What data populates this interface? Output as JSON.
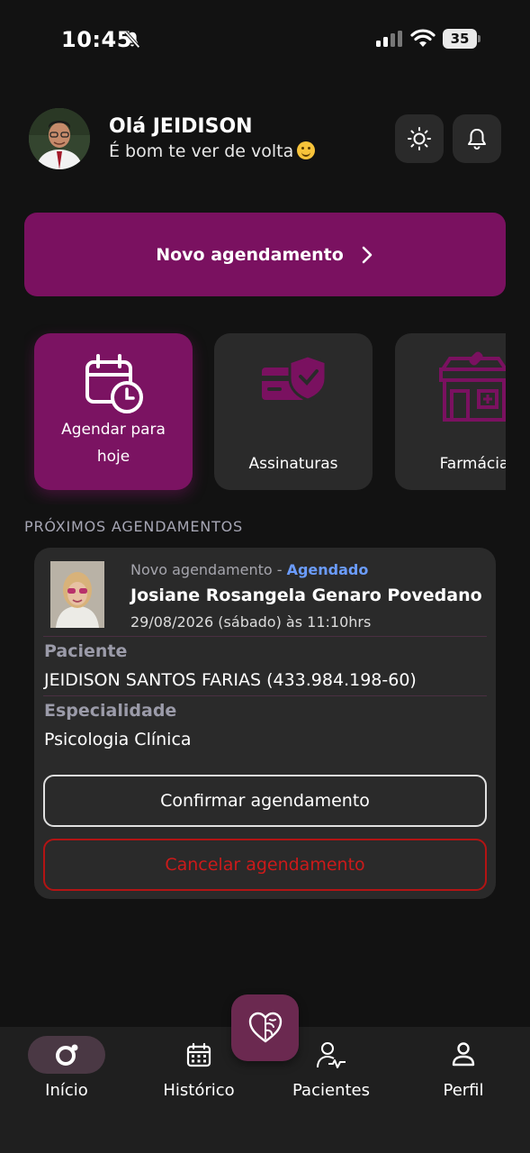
{
  "status_bar": {
    "time": "10:45",
    "battery": "35"
  },
  "header": {
    "greeting": "Olá JEIDISON",
    "subtitle": "É bom te ver de volta"
  },
  "cta": {
    "label": "Novo agendamento"
  },
  "quick_actions": [
    {
      "label": "Agendar para hoje",
      "icon": "calendar-clock-icon"
    },
    {
      "label": "Assinaturas",
      "icon": "card-shield-icon"
    },
    {
      "label": "Farmácia",
      "icon": "pharmacy-icon"
    }
  ],
  "section": {
    "title": "PRÓXIMOS AGENDAMENTOS"
  },
  "appointment": {
    "type": "Novo agendamento",
    "separator": " - ",
    "status": "Agendado",
    "professional": "Josiane Rosangela Genaro Povedano",
    "datetime": "29/08/2026 (sábado) às 11:10hrs",
    "patient_label": "Paciente",
    "patient_value": "JEIDISON SANTOS FARIAS (433.984.198-60)",
    "specialty_label": "Especialidade",
    "specialty_value": "Psicologia Clínica",
    "confirm_label": "Confirmar agendamento",
    "cancel_label": "Cancelar agendamento"
  },
  "bottom_nav": [
    {
      "label": "Início",
      "icon": "home-icon",
      "active": true
    },
    {
      "label": "Histórico",
      "icon": "calendar-icon"
    },
    {
      "label": "Pacientes",
      "icon": "patient-icon"
    },
    {
      "label": "Perfil",
      "icon": "profile-icon"
    }
  ],
  "colors": {
    "background": "#121212",
    "card": "#2a2a2a",
    "accent": "#7a1160",
    "status_blue": "#6b9cff",
    "danger": "#cc1a1a"
  }
}
